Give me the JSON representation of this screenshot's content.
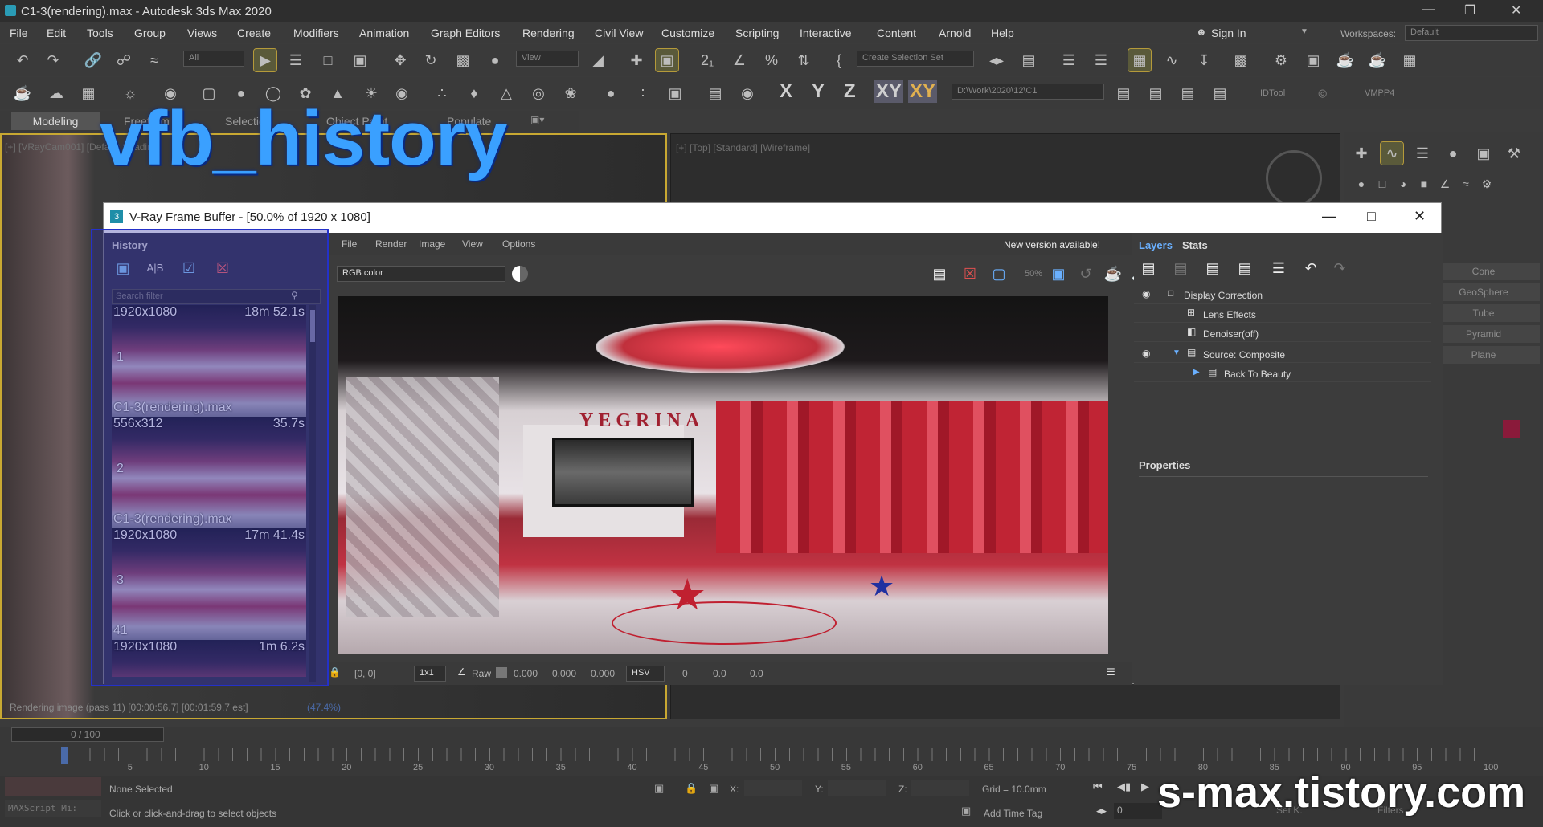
{
  "app": {
    "title": "C1-3(rendering).max - Autodesk 3ds Max 2020"
  },
  "menu": [
    "File",
    "Edit",
    "Tools",
    "Group",
    "Views",
    "Create",
    "Modifiers",
    "Animation",
    "Graph Editors",
    "Rendering",
    "Civil View",
    "Customize",
    "Scripting",
    "Interactive",
    "Content",
    "Arnold",
    "Help"
  ],
  "account": {
    "sign_in": "Sign In",
    "workspaces_label": "Workspaces:",
    "workspace": "Default"
  },
  "toolbar": {
    "selection_filter": "All",
    "view_dropdown": "View",
    "selection_set": "Create Selection Set",
    "project_path": "D:\\Work\\2020\\12\\C1",
    "idtool": "IDTool",
    "vmpp4": "VMPP4",
    "axes": [
      "X",
      "Y",
      "Z",
      "XY",
      "XY"
    ]
  },
  "ribbon_tabs": [
    "Modeling",
    "Freeform",
    "Selection",
    "Object Paint",
    "Populate"
  ],
  "viewports": {
    "left_label": "[+] [VRayCam001] [Default Shading]",
    "right_label": "[+] [Top] [Standard] [Wireframe]",
    "render_progress": "Rendering image (pass 11) [00:00:56.7] [00:01:59.7 est]",
    "render_pct": "(47.4%)"
  },
  "overlay_title": "vfb_history",
  "watermark": "s-max.tistory.com",
  "vfb": {
    "title": "V-Ray Frame Buffer - [50.0% of 1920 x 1080]",
    "menu": [
      "File",
      "Render",
      "Image",
      "View",
      "Options"
    ],
    "new_version": "New version available!",
    "channel": "RGB color",
    "zoom_label": "50%",
    "history_label": "History",
    "search_placeholder": "Search filter",
    "history": [
      {
        "res": "1920x1080",
        "time": "18m 52.1s",
        "num": "1",
        "name": "C1-3(rendering).max"
      },
      {
        "res": "556x312",
        "time": "35.7s",
        "num": "2",
        "name": "C1-3(rendering).max"
      },
      {
        "res": "1920x1080",
        "time": "17m 41.4s",
        "num": "3",
        "name": "41"
      },
      {
        "res": "1920x1080",
        "time": "1m 6.2s",
        "num": "",
        "name": ""
      }
    ],
    "status": {
      "coords": "[0, 0]",
      "ratio": "1x1",
      "raw": "Raw",
      "r": "0.000",
      "g": "0.000",
      "b": "0.000",
      "mode": "HSV",
      "h": "0",
      "s": "0.0",
      "v": "0.0"
    },
    "tabs": {
      "layers": "Layers",
      "stats": "Stats"
    },
    "layers": [
      {
        "name": "Display Correction",
        "eye": true
      },
      {
        "name": "Lens Effects",
        "eye": false
      },
      {
        "name": "Denoiser(off)",
        "eye": false
      },
      {
        "name": "Source: Composite",
        "eye": true
      },
      {
        "name": "Back To Beauty",
        "eye": false
      }
    ],
    "properties": "Properties",
    "scene_text": "YEGRINA"
  },
  "cmdpanel": {
    "objects": [
      "Cone",
      "GeoSphere",
      "Tube",
      "Pyramid",
      "Plane"
    ]
  },
  "timeline": {
    "frame": "0 / 100",
    "ticks": [
      "5",
      "10",
      "15",
      "20",
      "25",
      "30",
      "35",
      "40",
      "45",
      "50",
      "55",
      "60",
      "65",
      "70",
      "75",
      "80",
      "85",
      "90",
      "95",
      "100"
    ]
  },
  "status": {
    "selection": "None Selected",
    "hint": "Click or click-and-drag to select objects",
    "maxscript": "MAXScript Mi:",
    "x": "X:",
    "y": "Y:",
    "z": "Z:",
    "grid": "Grid = 10.0mm",
    "add_time_tag": "Add Time Tag",
    "frame_field": "0",
    "set_k": "Set K.",
    "filters": "Filters..."
  }
}
